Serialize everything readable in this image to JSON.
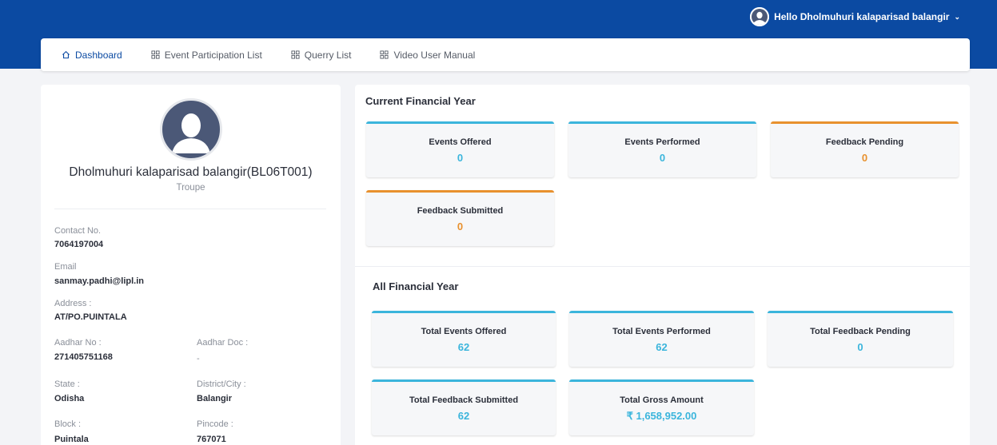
{
  "header": {
    "greeting": "Hello Dholmuhuri kalaparisad balangir",
    "caret": "⌄"
  },
  "nav": {
    "items": [
      {
        "label": "Dashboard",
        "icon": "home-icon"
      },
      {
        "label": "Event Participation List",
        "icon": "grid-icon"
      },
      {
        "label": "Querry List",
        "icon": "grid-icon"
      },
      {
        "label": "Video User Manual",
        "icon": "grid-icon"
      }
    ]
  },
  "profile": {
    "name": "Dholmuhuri kalaparisad balangir(BL06T001)",
    "role": "Troupe",
    "contact_label": "Contact No.",
    "contact_value": "7064197004",
    "email_label": "Email",
    "email_value": "sanmay.padhi@lipl.in",
    "address_label": "Address :",
    "address_value": "AT/PO.PUINTALA",
    "aadhar_label": "Aadhar No :",
    "aadhar_value": "271405751168",
    "aadhar_doc_label": "Aadhar Doc :",
    "aadhar_doc_value": "-",
    "state_label": "State :",
    "state_value": "Odisha",
    "district_label": "District/City :",
    "district_value": "Balangir",
    "block_label": "Block :",
    "block_value": "Puintala",
    "pincode_label": "Pincode :",
    "pincode_value": "767071"
  },
  "current_fy": {
    "title": "Current Financial Year",
    "cards": [
      {
        "label": "Events Offered",
        "value": "0"
      },
      {
        "label": "Events Performed",
        "value": "0"
      },
      {
        "label": "Feedback Pending",
        "value": "0"
      },
      {
        "label": "Feedback Submitted",
        "value": "0"
      }
    ]
  },
  "all_fy": {
    "title": "All Financial Year",
    "cards": [
      {
        "label": "Total Events Offered",
        "value": "62"
      },
      {
        "label": "Total Events Performed",
        "value": "62"
      },
      {
        "label": "Total Feedback Pending",
        "value": "0"
      },
      {
        "label": "Total Feedback Submitted",
        "value": "62"
      },
      {
        "label": "Total Gross Amount",
        "value": "₹ 1,658,952.00"
      }
    ]
  },
  "colors": {
    "brand": "#0b4aa2",
    "accent_blue": "#3bb5dc",
    "accent_orange": "#e8912e"
  }
}
